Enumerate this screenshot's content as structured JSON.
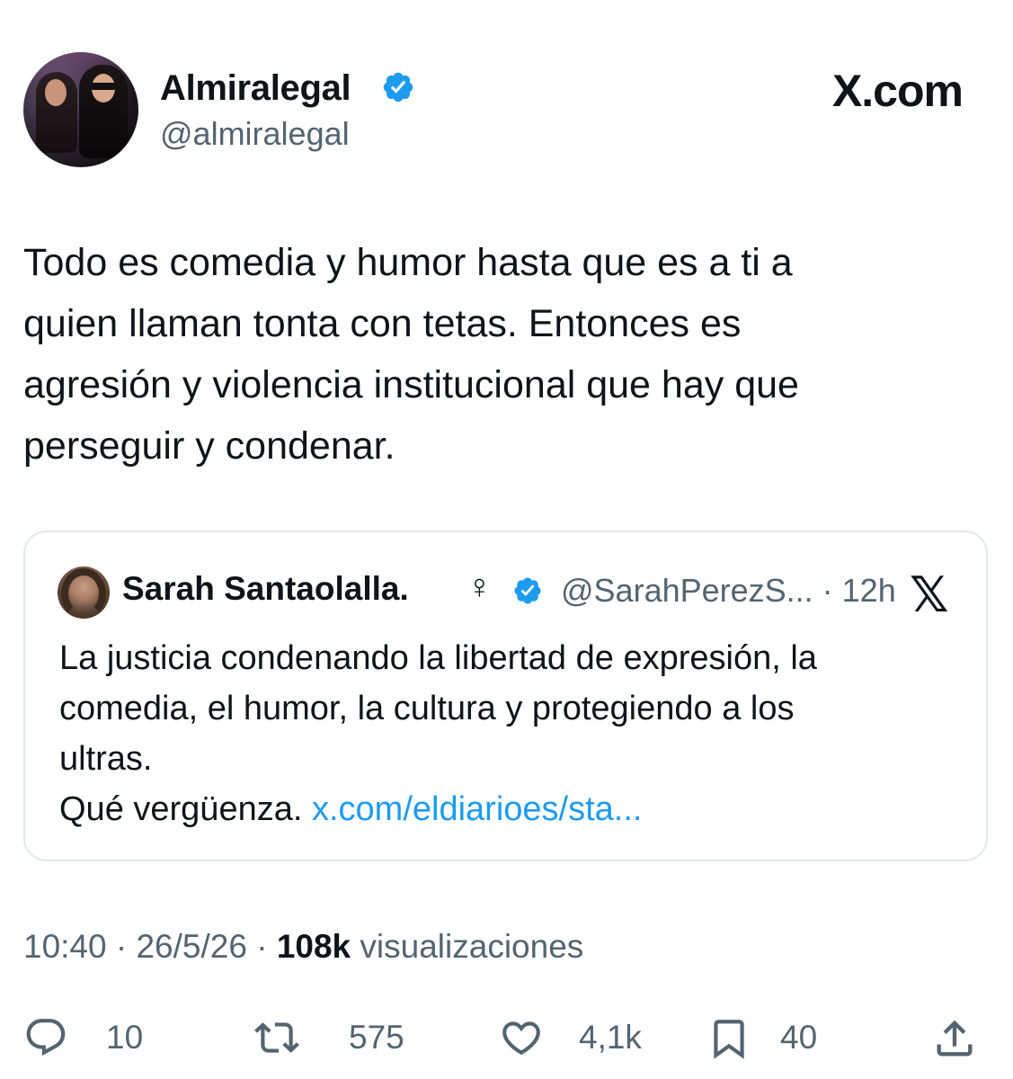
{
  "brand": {
    "label": "X.com"
  },
  "author": {
    "name": "Almiralegal",
    "handle": "@almiralegal",
    "verified_color": "#1d9bf0",
    "avatar_icon": "avatar-photo"
  },
  "tweet": {
    "text_lines": [
      "Todo es comedia y humor hasta que es a ti a",
      "quien llaman tonta con tetas. Entonces es",
      "agresión y violencia institucional que hay que",
      "perseguir y condenar."
    ]
  },
  "quote": {
    "name": "Sarah Santaolalla.",
    "symbol": "♀",
    "handle_time": "@SarahPerezS... · 12h",
    "x_logo": "𝕏",
    "text_lines": [
      "La justicia condenando la libertad de expresión, la",
      "comedia, el humor, la cultura y protegiendo a los",
      "ultras."
    ],
    "last_line_text": "Qué vergüenza.",
    "link": "x.com/eldiarioes/sta...",
    "link_color": "#1d9bf0"
  },
  "meta": {
    "time": "10:40",
    "date": "26/5/26",
    "sep": "·",
    "views_count": "108k",
    "views_label": "visualizaciones"
  },
  "actions": {
    "replies": "10",
    "reposts": "575",
    "likes": "4,1k",
    "bookmarks": "40"
  }
}
